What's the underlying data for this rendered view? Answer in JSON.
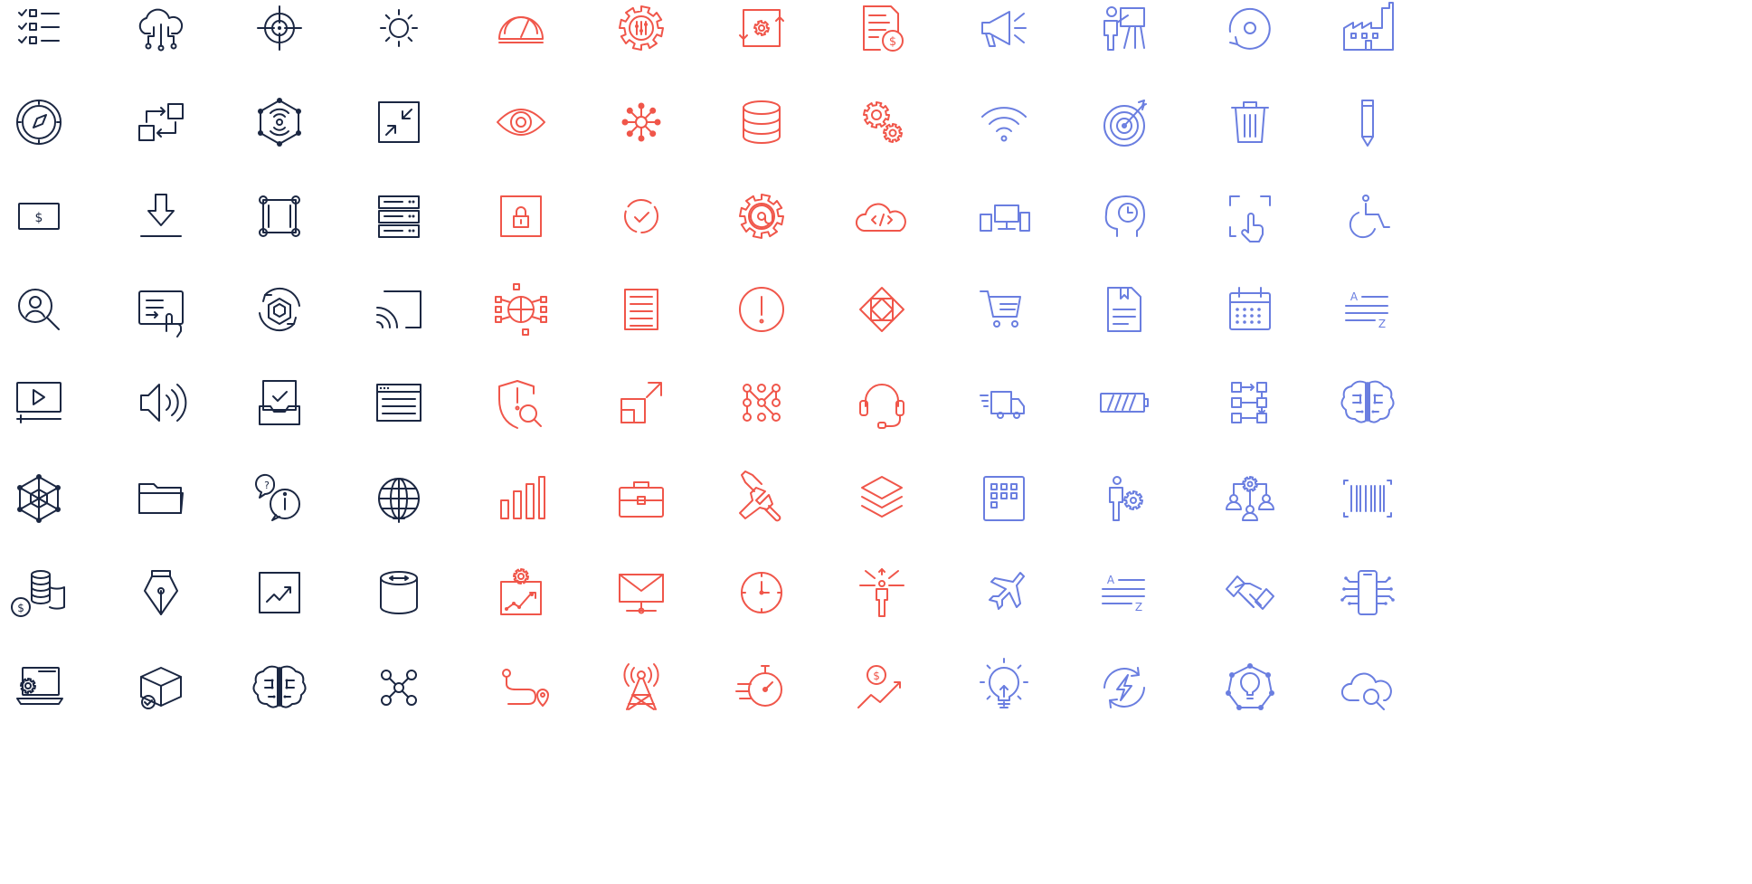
{
  "colors": {
    "navy": "#1b2742",
    "coral": "#f0564a",
    "periwinkle": "#6a7ee0"
  },
  "column_colors": [
    "navy",
    "navy",
    "navy",
    "navy",
    "coral",
    "coral",
    "coral",
    "coral",
    "periwinkle",
    "periwinkle",
    "periwinkle",
    "periwinkle"
  ],
  "icons": [
    [
      "checklist-icon",
      "cloud-network-icon",
      "crosshair-target-icon",
      "sun-icon",
      "speedometer-icon",
      "settings-sliders-gear-icon",
      "automation-gear-frame-icon",
      "invoice-dollar-icon",
      "megaphone-icon",
      "presenter-board-icon",
      "disc-refresh-icon",
      "factory-icon"
    ],
    [
      "compass-icon",
      "data-transfer-icon",
      "iot-sensor-icon",
      "minimize-arrows-icon",
      "eye-icon",
      "network-hub-icon",
      "database-icon",
      "gears-icon",
      "wifi-icon",
      "target-arrow-icon",
      "trash-icon",
      "pencil-icon"
    ],
    [
      "dollar-bill-icon",
      "download-icon",
      "frame-nodes-icon",
      "server-rack-icon",
      "padlock-box-icon",
      "dashed-check-circle-icon",
      "at-gear-icon",
      "cloud-code-icon",
      "devices-icon",
      "head-clock-icon",
      "touch-scan-icon",
      "wheelchair-icon"
    ],
    [
      "user-search-icon",
      "touch-screen-icon",
      "cube-cycle-icon",
      "cast-icon",
      "circuit-globe-icon",
      "document-lines-icon",
      "alert-circle-icon",
      "diamond-frame-icon",
      "shopping-cart-icon",
      "document-bookmark-icon",
      "calendar-icon",
      "sort-a-z-icon"
    ],
    [
      "video-player-icon",
      "speaker-icon",
      "inbox-check-icon",
      "browser-window-icon",
      "shield-search-icon",
      "expand-square-icon",
      "dot-pattern-icon",
      "headset-icon",
      "delivery-truck-icon",
      "battery-icon",
      "flow-diagram-icon",
      "brain-circuit-icon"
    ],
    [
      "hexagon-network-icon",
      "folder-icon",
      "chat-info-icon",
      "globe-icon",
      "bar-chart-icon",
      "briefcase-icon",
      "tools-icon",
      "layers-icon",
      "app-grid-icon",
      "person-gear-icon",
      "team-hierarchy-icon",
      "barcode-icon"
    ],
    [
      "coins-dollar-icon",
      "pen-nib-icon",
      "trend-chart-icon",
      "storage-cylinder-icon",
      "growth-chart-gear-icon",
      "email-network-icon",
      "clock-icon",
      "person-direction-icon",
      "airplane-icon",
      "sort-a-z-icon",
      "handshake-icon",
      "phone-circuit-icon"
    ],
    [
      "laptop-gear-icon",
      "box-check-icon",
      "brain-circuit-icon",
      "molecule-icon",
      "route-pin-icon",
      "signal-tower-icon",
      "stopwatch-speed-icon",
      "dollar-growth-icon",
      "lightbulb-icon",
      "power-refresh-icon",
      "idea-network-icon",
      "cloud-search-icon"
    ]
  ]
}
